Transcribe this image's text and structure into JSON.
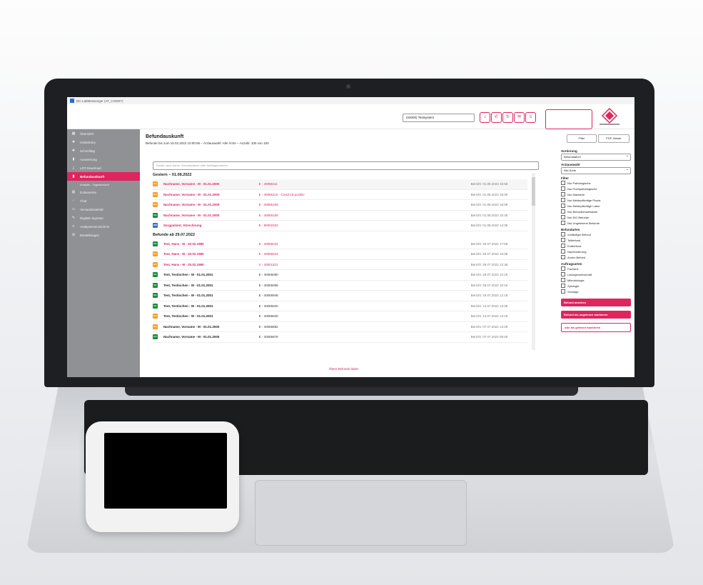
{
  "window": {
    "title": "DC-LabMessenger (AT_COM27)"
  },
  "topbar": {
    "system_select": "(04000) Testsystem"
  },
  "sidebar": {
    "items": [
      {
        "label": "Übersicht",
        "icon": "grid-icon"
      },
      {
        "label": "OrderEntry",
        "icon": "plus-icon"
      },
      {
        "label": "Schnelltag",
        "icon": "plus-icon"
      },
      {
        "label": "Auswertung",
        "icon": "chart-icon"
      },
      {
        "label": "LDT-Download",
        "icon": "download-icon"
      },
      {
        "label": "Befundauskunft",
        "icon": "chart-icon"
      }
    ],
    "sub_items": [
      {
        "label": "Analytik - Tagesansicht"
      }
    ],
    "items2": [
      {
        "label": "Dokumente",
        "icon": "doc-icon"
      },
      {
        "label": "Chat",
        "icon": "chat-icon"
      },
      {
        "label": "Versandmaterial",
        "icon": "box-icon"
      },
      {
        "label": "Digitale Signatur",
        "icon": "pen-icon"
      },
      {
        "label": "Analysenverzeichnis",
        "icon": "list-icon"
      },
      {
        "label": "Einstellungen",
        "icon": "gear-icon"
      }
    ]
  },
  "main": {
    "title": "Befundauskunft",
    "subtitle": "Befunde bis zum 15.02.2022 10:00:06 – Arztauswahl: Alle Ärzte – Anzahl: 100 von 100",
    "search_placeholder": "Suche nach Name, Geburtsdatum oder Auftragsnummer",
    "groups": [
      {
        "label": "Gestern – 01.08.2022",
        "rows": [
          {
            "badge": "EA",
            "color": "orange",
            "name": "Nachname, Vorname - M - 01.01.2000",
            "id": "E - 40065111",
            "date": "Bericht: 01.08.2022 15:58",
            "pink": true,
            "hl": true
          },
          {
            "badge": "EA",
            "color": "orange",
            "name": "Nachname, Vorname - M - 01.01.2000",
            "id": "E - 40065110 - Covid-19 positiv!",
            "date": "Bericht: 01.08.2022 16:08",
            "pink": true
          },
          {
            "badge": "EA",
            "color": "orange",
            "name": "Nachname, Vorname - M - 01.01.2000",
            "id": "E - 40065109",
            "date": "Bericht: 01.08.2022 16:08",
            "pink": true
          },
          {
            "badge": "EA",
            "color": "green",
            "name": "Nachname, Vorname - M - 01.01.2000",
            "id": "E - 40065108",
            "date": "Bericht: 01.08.2022 15:28",
            "pink": true
          },
          {
            "badge": "WB",
            "color": "blue",
            "name": "Sergpatient, Abrechnung",
            "id": "E - 90002333",
            "date": "Bericht: 01.08.2022 14:38",
            "pink": true
          }
        ]
      },
      {
        "label": "Befunde ab 29.07.2022",
        "rows": [
          {
            "badge": "EA",
            "color": "green",
            "name": "Test, Hans - M - 20.02.1980",
            "id": "E - 40065042",
            "date": "Bericht: 29.07.2022 17:58",
            "pink": true
          },
          {
            "badge": "EA",
            "color": "orange",
            "name": "Test, Hans - M - 20.02.1980",
            "id": "E - 40065043",
            "date": "Bericht: 29.07.2022 16:08",
            "pink": true
          },
          {
            "badge": "EA",
            "color": "orange",
            "name": "Test, Hans - M - 20.02.1980",
            "id": "V - 40001101",
            "date": "Bericht: 29.07.2022 12:38",
            "pink": true
          },
          {
            "badge": "EA",
            "color": "green",
            "name": "Test, Testinchen - W - 01.01.2001",
            "id": "E - 40065090",
            "date": "Bericht: 28.07.2022 10:18",
            "pink": false
          },
          {
            "badge": "EA",
            "color": "green",
            "name": "Test, Testinchen - W - 01.01.2001",
            "id": "E - 40065089",
            "date": "Bericht: 28.07.2022 10:18",
            "pink": false
          },
          {
            "badge": "EA",
            "color": "green",
            "name": "Test, Testinchen - W - 01.01.2001",
            "id": "E - 40065948",
            "date": "Bericht: 19.07.2022 12:18",
            "pink": false
          },
          {
            "badge": "EA",
            "color": "green",
            "name": "Test, Testinchen - W - 01.01.2001",
            "id": "E - 40065940",
            "date": "Bericht: 14.07.2022 13:28",
            "pink": false
          },
          {
            "badge": "EA",
            "color": "orange",
            "name": "Test, Testinchen - W - 01.01.2001",
            "id": "E - 40065940",
            "date": "Bericht: 14.07.2022 13:18",
            "pink": false
          },
          {
            "badge": "EA",
            "color": "orange",
            "name": "Nachname, Vorname - M - 01.01.2000",
            "id": "E - 40065882",
            "date": "Bericht: 07.07.2022 13:28",
            "pink": false
          },
          {
            "badge": "EA",
            "color": "green",
            "name": "Nachname, Vorname - M - 01.01.2000",
            "id": "E - 40065878",
            "date": "Bericht: 07.07.2022 09:28",
            "pink": false
          }
        ]
      }
    ],
    "load_more": "Ältere Befunde laden"
  },
  "right_panel": {
    "btn_filter": "Filter",
    "btn_pdf": "PDF-Viewer",
    "sort_label": "Sortierung",
    "sort_value": "Befunddatum",
    "doctor_label": "Arztauswahl",
    "doctor_value": "Alle Ärzte",
    "filter_label": "Filter",
    "filters": [
      "Nur Pathologische",
      "Nur Hochpathologische",
      "Nur Markierte",
      "Nur Meldepflichtige Praxis",
      "Nur Meldepflichtige Labor",
      "Nur Befundhinweisteste",
      "Nur EiG Befunde",
      "Nur Ungelesene Befunde"
    ],
    "types_label": "Befundarten",
    "types": [
      "Vorläufiger Befund",
      "Teilbefund",
      "Endbefund",
      "Nachforderung",
      "Archiv-Befund"
    ],
    "orders_label": "Auftragsarten",
    "orders": [
      "Facharzt",
      "Laborgemeinschaft",
      "Mikrobiologie",
      "Zytologie",
      "Sonstige"
    ],
    "btn_show": "Befund ansehen",
    "btn_mark_unread": "Befund als ungelesen markieren",
    "btn_mark_all_read": "Alle als gelesen markieren"
  },
  "colors": {
    "accent": "#e0245e",
    "sidebar": "#8f9195",
    "badge_orange": "#f59f2c",
    "badge_green": "#1c8c3a",
    "badge_blue": "#3a6fd0"
  }
}
